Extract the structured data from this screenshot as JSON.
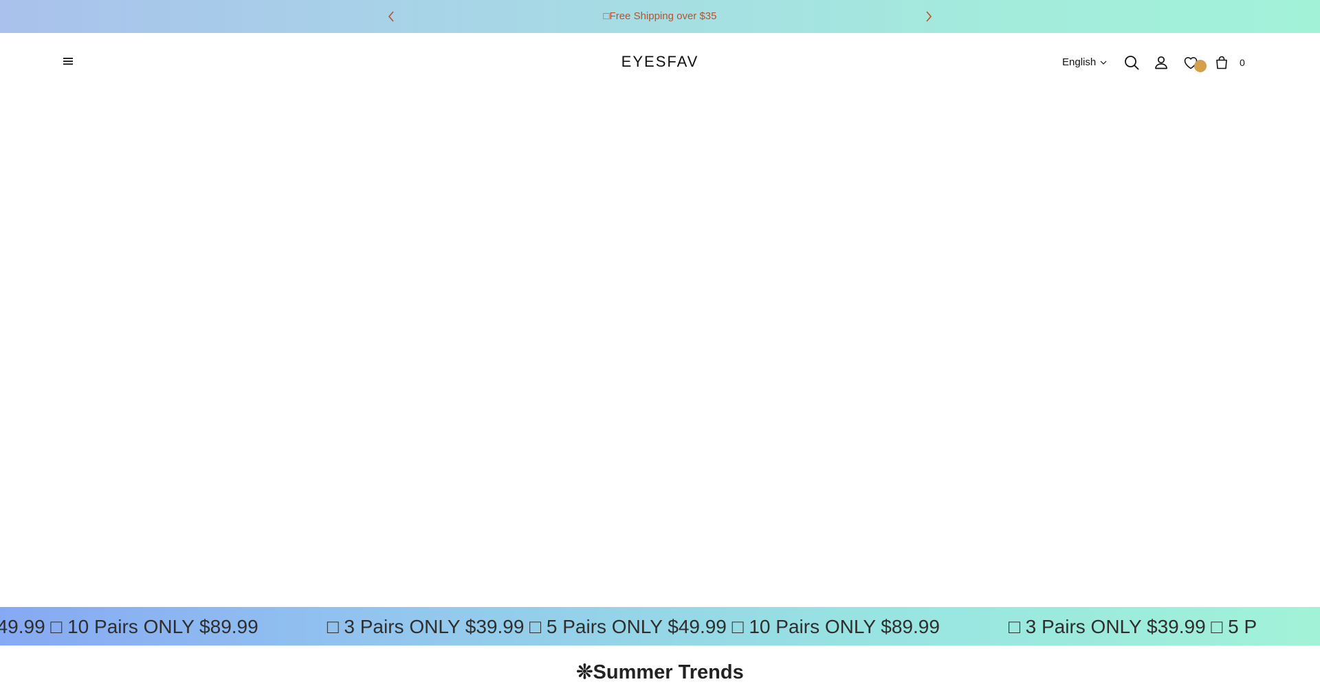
{
  "announcement": {
    "message": "□Free Shipping over $35"
  },
  "header": {
    "logo": "EYESFAV",
    "language": "English",
    "cart_count": "0"
  },
  "ticker": {
    "items": [
      "$49.99 □ 10 Pairs ONLY $89.99",
      "□ 3 Pairs ONLY $39.99 □ 5 Pairs ONLY $49.99 □ 10 Pairs ONLY $89.99",
      "□ 3 Pairs ONLY $39.99 □ 5 P"
    ]
  },
  "section": {
    "title": "❊Summer Trends"
  },
  "colors": {
    "announcement_text": "#b5532e",
    "wishlist_badge": "#d4a04e"
  }
}
